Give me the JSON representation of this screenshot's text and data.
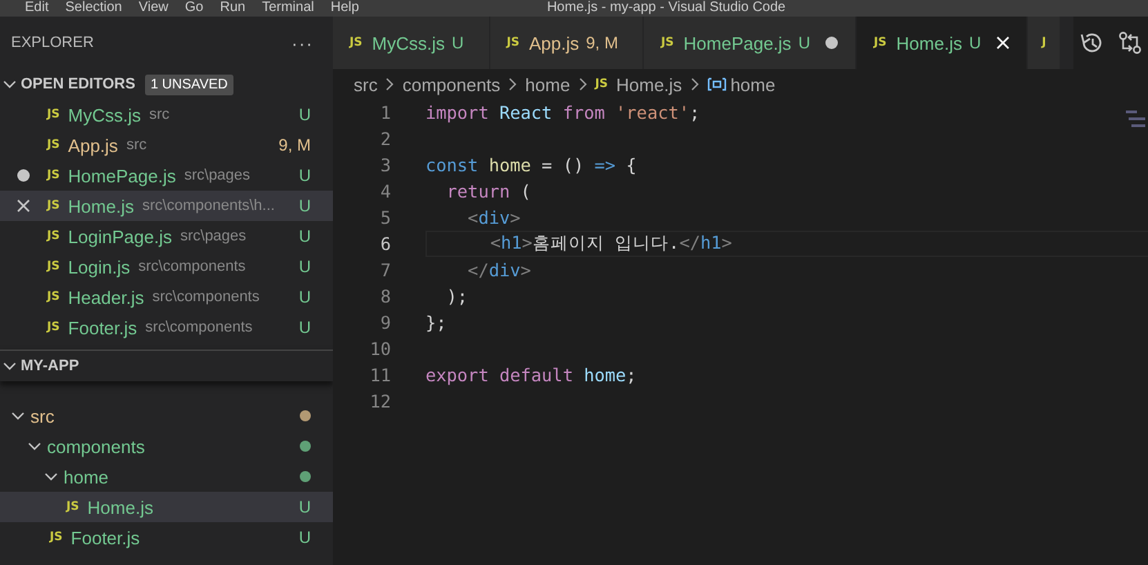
{
  "menu_bar": {
    "items": [
      "Edit",
      "Selection",
      "View",
      "Go",
      "Run",
      "Terminal",
      "Help"
    ],
    "title": "Home.js - my-app - Visual Studio Code"
  },
  "sidebar": {
    "title": "EXPLORER",
    "more": "···",
    "open_editors": {
      "label": "OPEN EDITORS",
      "badge": "1 UNSAVED",
      "expanded": true,
      "items": [
        {
          "icon": "JS",
          "name": "MyCss.js",
          "path": "src",
          "status": "U",
          "color": "#73c991",
          "dirty": false,
          "selected": false
        },
        {
          "icon": "JS",
          "name": "App.js",
          "path": "src",
          "status": "9, M",
          "color": "#e2c08d",
          "dirty": false,
          "selected": false
        },
        {
          "icon": "JS",
          "name": "HomePage.js",
          "path": "src\\pages",
          "status": "U",
          "color": "#73c991",
          "dirty": true,
          "selected": false
        },
        {
          "icon": "JS",
          "name": "Home.js",
          "path": "src\\components\\h...",
          "status": "U",
          "color": "#73c991",
          "dirty": false,
          "selected": true
        },
        {
          "icon": "JS",
          "name": "LoginPage.js",
          "path": "src\\pages",
          "status": "U",
          "color": "#73c991",
          "dirty": false,
          "selected": false
        },
        {
          "icon": "JS",
          "name": "Login.js",
          "path": "src\\components",
          "status": "U",
          "color": "#73c991",
          "dirty": false,
          "selected": false
        },
        {
          "icon": "JS",
          "name": "Header.js",
          "path": "src\\components",
          "status": "U",
          "color": "#73c991",
          "dirty": false,
          "selected": false
        },
        {
          "icon": "JS",
          "name": "Footer.js",
          "path": "src\\components",
          "status": "U",
          "color": "#73c991",
          "dirty": false,
          "selected": false
        }
      ]
    },
    "project": {
      "label": "MY-APP",
      "expanded": true,
      "tree": [
        {
          "kind": "folder",
          "name": "src",
          "color": "#e2c08d",
          "expanded": true,
          "selected": false,
          "children": [
            {
              "kind": "folder",
              "name": "components",
              "color": "#73c991",
              "expanded": true,
              "selected": false,
              "children": [
                {
                  "kind": "folder",
                  "name": "home",
                  "color": "#73c991",
                  "expanded": true,
                  "selected": false,
                  "children": [
                    {
                      "kind": "file",
                      "icon": "JS",
                      "name": "Home.js",
                      "status": "U",
                      "color": "#73c991",
                      "selected": true
                    }
                  ]
                },
                {
                  "kind": "file",
                  "icon": "JS",
                  "name": "Footer.js",
                  "status": "U",
                  "color": "#73c991",
                  "selected": false
                }
              ]
            }
          ]
        }
      ]
    }
  },
  "tabs": [
    {
      "icon": "JS",
      "name": "MyCss.js",
      "status": "U",
      "color": "#73c991",
      "dirty": false,
      "selected": false
    },
    {
      "icon": "JS",
      "name": "App.js",
      "status": "9, M",
      "color": "#e2c08d",
      "dirty": false,
      "selected": false
    },
    {
      "icon": "JS",
      "name": "HomePage.js",
      "status": "U",
      "color": "#73c991",
      "dirty": true,
      "selected": false
    },
    {
      "icon": "JS",
      "name": "Home.js",
      "status": "U",
      "color": "#73c991",
      "dirty": false,
      "selected": true
    },
    {
      "icon": "J",
      "selected": false
    }
  ],
  "breadcrumb": [
    {
      "kind": "folder",
      "label": "src"
    },
    {
      "kind": "folder",
      "label": "components"
    },
    {
      "kind": "folder",
      "label": "home"
    },
    {
      "kind": "file",
      "icon": "JS",
      "label": "Home.js"
    },
    {
      "kind": "symbol",
      "label": "home"
    }
  ],
  "editor": {
    "lines": [
      {
        "number": "1",
        "current": false,
        "tokens": [
          {
            "kind": "control",
            "text": "import "
          },
          {
            "kind": "variable",
            "text": "React "
          },
          {
            "kind": "control",
            "text": "from "
          },
          {
            "kind": "string",
            "text": "'react'"
          },
          {
            "kind": "plain",
            "text": ";"
          }
        ]
      },
      {
        "number": "2",
        "current": false
      },
      {
        "number": "3",
        "current": false,
        "tokens": [
          {
            "kind": "storage",
            "text": "const "
          },
          {
            "kind": "function",
            "text": "home"
          },
          {
            "kind": "plain",
            "text": " = () "
          },
          {
            "kind": "storage",
            "text": "=>"
          },
          {
            "kind": "plain",
            "text": " {"
          }
        ]
      },
      {
        "number": "4",
        "current": false,
        "tokens": [
          {
            "kind": "control",
            "text": "  return"
          },
          {
            "kind": "plain",
            "text": " ("
          }
        ]
      },
      {
        "number": "5",
        "current": false,
        "tokens": [
          {
            "kind": "bracket",
            "text": "    <"
          },
          {
            "kind": "tag",
            "text": "div"
          },
          {
            "kind": "bracket",
            "text": ">"
          }
        ]
      },
      {
        "number": "6",
        "current": true,
        "tokens": [
          {
            "kind": "bracket",
            "text": "      <"
          },
          {
            "kind": "tag",
            "text": "h1"
          },
          {
            "kind": "bracket",
            "text": ">"
          },
          {
            "kind": "plain",
            "text": "홈페이지 입니다."
          },
          {
            "kind": "bracket",
            "text": "</"
          },
          {
            "kind": "tag",
            "text": "h1"
          },
          {
            "kind": "bracket",
            "text": ">"
          }
        ]
      },
      {
        "number": "7",
        "current": false,
        "tokens": [
          {
            "kind": "bracket",
            "text": "    </"
          },
          {
            "kind": "tag",
            "text": "div"
          },
          {
            "kind": "bracket",
            "text": ">"
          }
        ]
      },
      {
        "number": "8",
        "current": false,
        "tokens": [
          {
            "kind": "plain",
            "text": "  );"
          }
        ]
      },
      {
        "number": "9",
        "current": false,
        "tokens": [
          {
            "kind": "plain",
            "text": "};"
          }
        ]
      },
      {
        "number": "10",
        "current": false
      },
      {
        "number": "11",
        "current": false,
        "tokens": [
          {
            "kind": "control",
            "text": "export "
          },
          {
            "kind": "control",
            "text": "default "
          },
          {
            "kind": "variable",
            "text": "home"
          },
          {
            "kind": "plain",
            "text": ";"
          }
        ]
      },
      {
        "number": "12",
        "current": false
      }
    ]
  }
}
